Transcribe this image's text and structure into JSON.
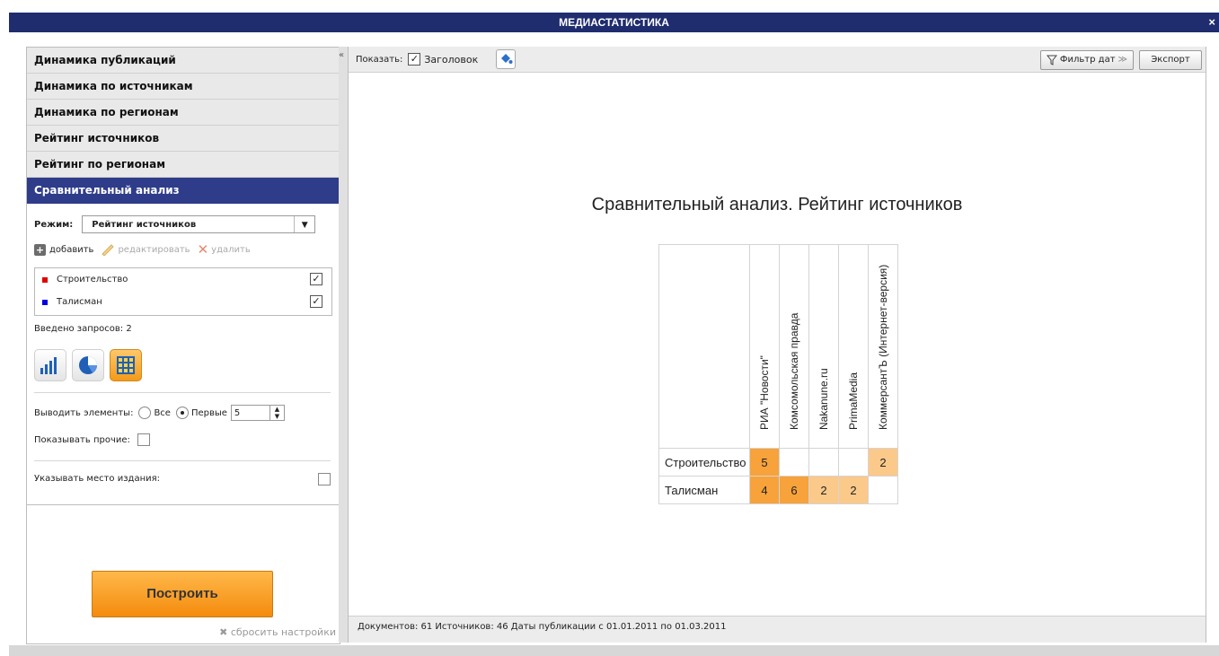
{
  "window": {
    "title": "МЕДИАСТАТИСТИКА",
    "close": "×"
  },
  "nav": {
    "items": [
      {
        "label": "Динамика публикаций",
        "active": false
      },
      {
        "label": "Динамика по источникам",
        "active": false
      },
      {
        "label": "Динамика по регионам",
        "active": false
      },
      {
        "label": "Рейтинг источников",
        "active": false
      },
      {
        "label": "Рейтинг по регионам",
        "active": false
      },
      {
        "label": "Сравнительный анализ",
        "active": true
      }
    ]
  },
  "panel": {
    "mode_label": "Режим:",
    "mode_value": "Рейтинг источников",
    "add": "добавить",
    "edit": "редактировать",
    "delete": "удалить",
    "queries": [
      {
        "name": "Строительство",
        "color": "#e00000",
        "checked": "✓"
      },
      {
        "name": "Талисман",
        "color": "#0000e0",
        "checked": "✓"
      }
    ],
    "count_text": "Введено запросов: 2",
    "elements_label": "Выводить элементы:",
    "all_label": "Все",
    "first_label": "Первые",
    "first_value": "5",
    "show_other": "Показывать прочие:",
    "show_place": "Указывать место издания:",
    "build": "Построить",
    "reset": "✖ сбросить настройки"
  },
  "toolbar": {
    "show_label": "Показать:",
    "header_check": "✓",
    "header_label": "Заголовок",
    "filter": "Фильтр дат",
    "filter_arrow": "≫",
    "export": "Экспорт"
  },
  "collapse": "«",
  "colors": {
    "accent": "#2e3c8a",
    "title": "#1f2d6e",
    "cell_dark": "#f7a23a",
    "cell_light": "#fbc98a"
  },
  "chart_data": {
    "type": "table",
    "title": "Сравнительный анализ. Рейтинг источников",
    "columns": [
      "РИА \"Новости\"",
      "Комсомольская правда",
      "Nakanune.ru",
      "PrimaMedia",
      "КоммерсантЪ (Интернет-версия)"
    ],
    "rows": [
      {
        "name": "Строительство",
        "values": [
          "5",
          "",
          "",
          "",
          "2"
        ]
      },
      {
        "name": "Талисман",
        "values": [
          "4",
          "6",
          "2",
          "2",
          ""
        ]
      }
    ]
  },
  "status": "Документов: 61   Источников: 46   Даты публикации с 01.01.2011 по 01.03.2011"
}
